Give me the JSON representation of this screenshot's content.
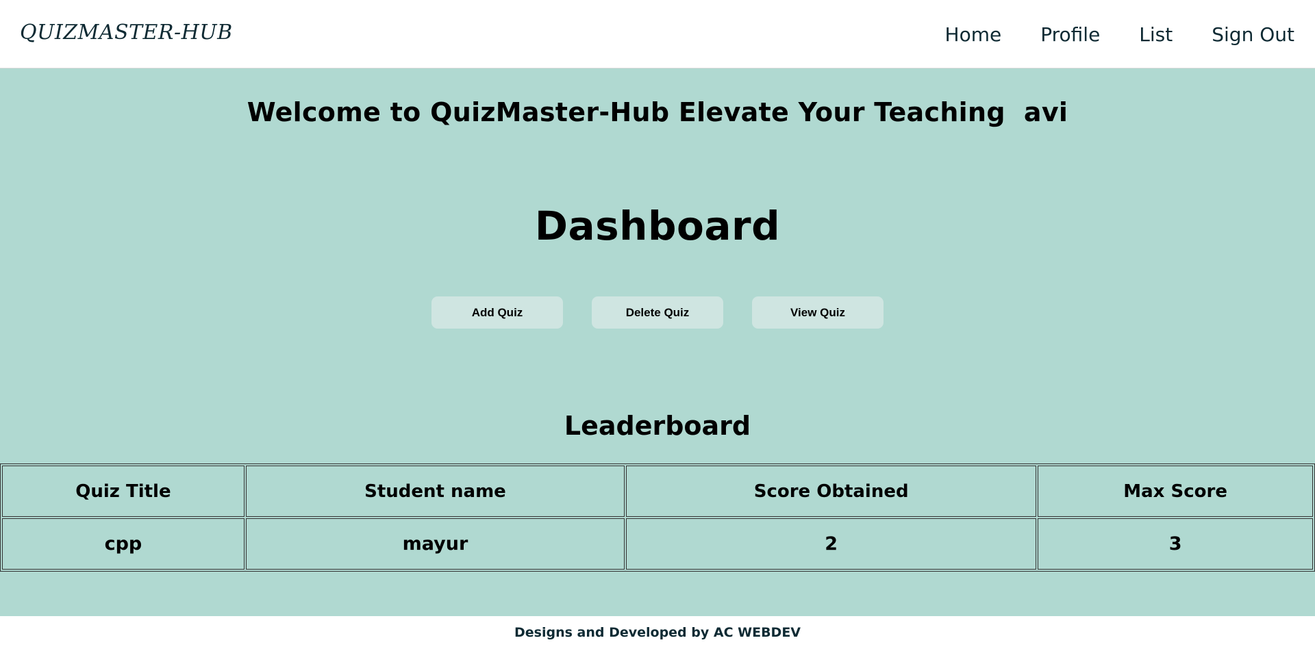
{
  "navbar": {
    "brand": "QUIZMASTER-HUB",
    "links": [
      "Home",
      "Profile",
      "List",
      "Sign Out"
    ]
  },
  "main": {
    "welcome": "Welcome to QuizMaster-Hub Elevate Your Teaching  avi",
    "dashboard_title": "Dashboard",
    "actions": [
      "Add Quiz",
      "Delete Quiz",
      "View Quiz"
    ],
    "leaderboard": {
      "title": "Leaderboard",
      "columns": [
        "Quiz Title",
        "Student name",
        "Score Obtained",
        "Max Score"
      ],
      "rows": [
        [
          "cpp",
          "mayur",
          "2",
          "3"
        ]
      ]
    }
  },
  "footer": {
    "text": "Designs and Developed by AC WEBDEV"
  },
  "colors": {
    "background": "#b0d9d1",
    "button": "#cfe5e1",
    "nav_text": "#0e2a33"
  }
}
